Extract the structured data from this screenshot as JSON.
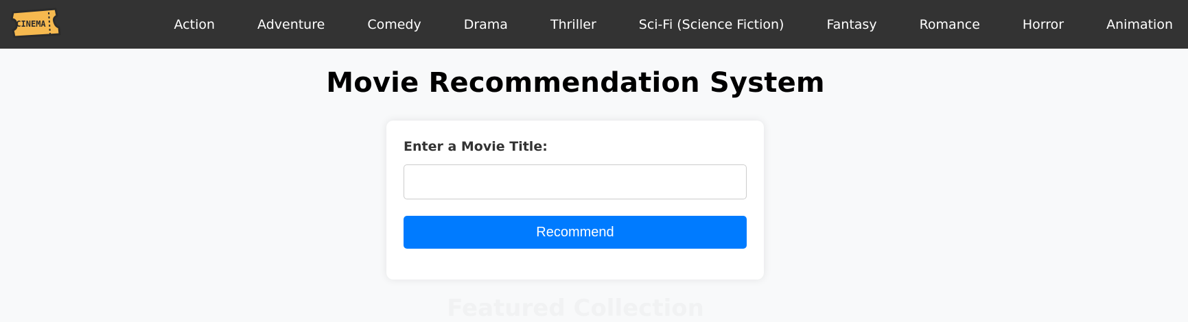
{
  "navbar": {
    "logo_text": "CINEMA",
    "logo_colors": {
      "fill": "#f6b94f",
      "stroke": "#2b2b2b"
    },
    "items": [
      {
        "label": "Action"
      },
      {
        "label": "Adventure"
      },
      {
        "label": "Comedy"
      },
      {
        "label": "Drama"
      },
      {
        "label": "Thriller"
      },
      {
        "label": "Sci-Fi (Science Fiction)"
      },
      {
        "label": "Fantasy"
      },
      {
        "label": "Romance"
      },
      {
        "label": "Horror"
      },
      {
        "label": "Animation"
      }
    ],
    "background": "#333333"
  },
  "main": {
    "title": "Movie Recommendation System",
    "form": {
      "label": "Enter a Movie Title:",
      "input_value": "",
      "button_label": "Recommend",
      "button_color": "#007bff"
    },
    "featured_title": "Featured Collection"
  }
}
